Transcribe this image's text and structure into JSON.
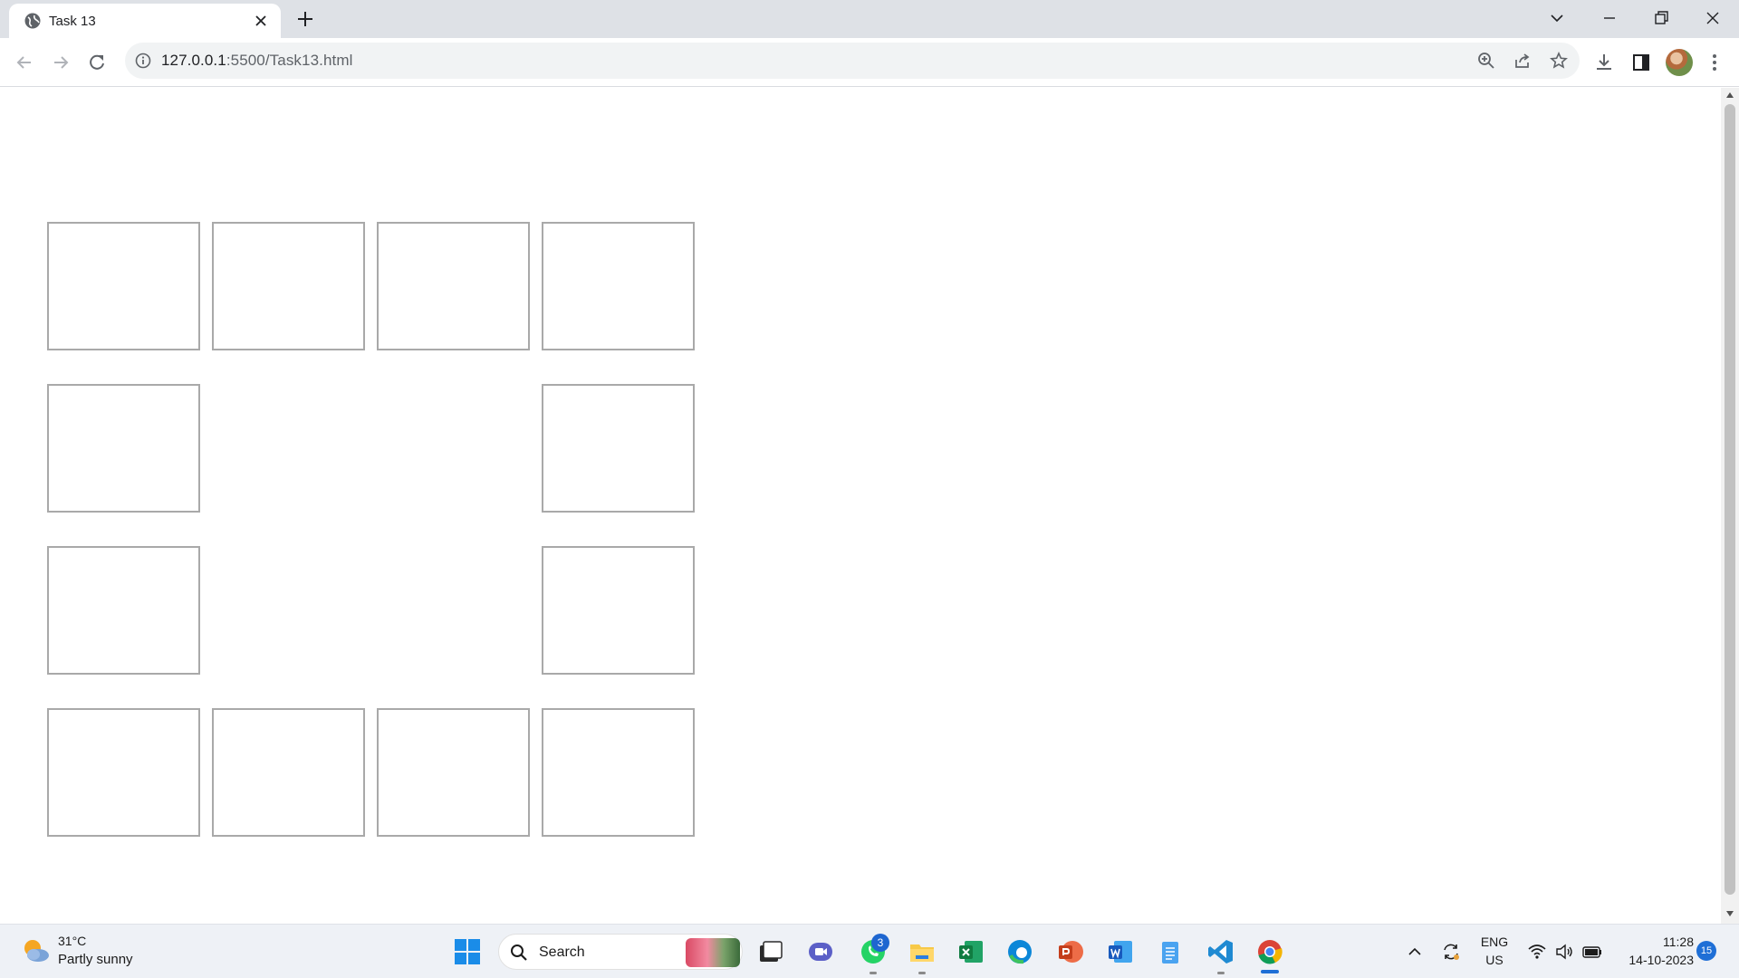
{
  "browser": {
    "tab": {
      "title": "Task 13",
      "favicon": "globe-icon"
    },
    "address": {
      "host": "127.0.0.1",
      "rest": ":5500/Task13.html"
    },
    "icons": [
      "back-icon",
      "forward-icon",
      "reload-icon",
      "info-icon",
      "zoom-icon",
      "share-icon",
      "star-icon",
      "download-icon",
      "side-panel-icon",
      "menu-icon"
    ]
  },
  "page": {
    "grid": [
      [
        1,
        1,
        1,
        1
      ],
      [
        1,
        0,
        0,
        1
      ],
      [
        1,
        0,
        0,
        1
      ],
      [
        1,
        1,
        1,
        1
      ]
    ],
    "box_border_color": "#a9a9a9"
  },
  "taskbar": {
    "weather": {
      "temp": "31°C",
      "desc": "Partly sunny"
    },
    "search": {
      "label": "Search"
    },
    "apps": [
      "windows-start-icon",
      "search-icon",
      "task-view-icon",
      "teams-icon",
      "whatsapp-icon",
      "file-explorer-icon",
      "excel-icon",
      "edge-icon",
      "powerpoint-icon",
      "word-icon",
      "notepad-icon",
      "vscode-icon",
      "chrome-icon"
    ],
    "whatsapp_badge": "3",
    "tray": {
      "lang_top": "ENG",
      "lang_bottom": "US",
      "time": "11:28",
      "date": "14-10-2023",
      "notifications": "15"
    },
    "accent": "#1f6fd6"
  }
}
